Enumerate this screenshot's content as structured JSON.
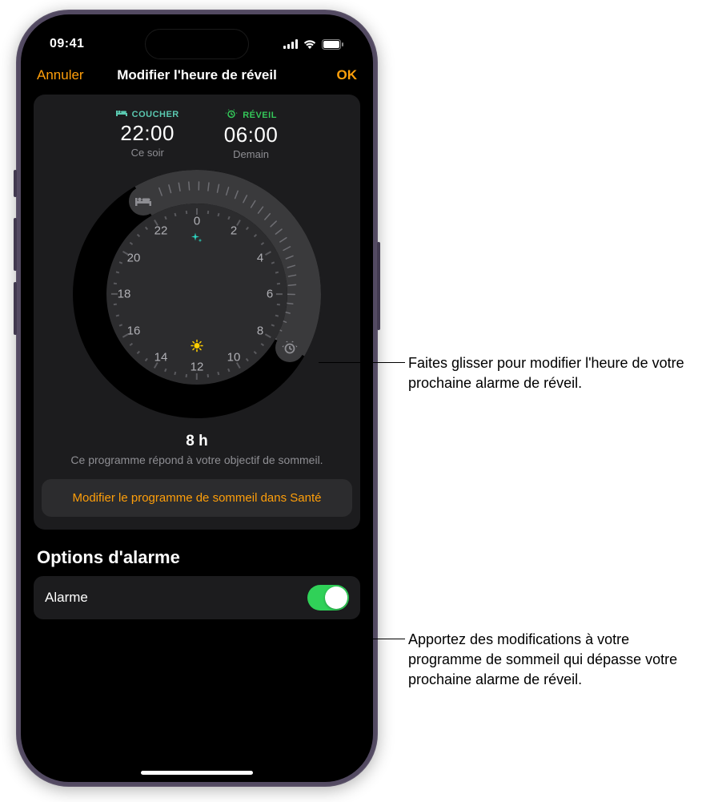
{
  "status": {
    "time": "09:41"
  },
  "nav": {
    "cancel": "Annuler",
    "title": "Modifier l'heure de réveil",
    "ok": "OK"
  },
  "schedule": {
    "bed_label": "COUCHER",
    "bed_time": "22:00",
    "bed_sub": "Ce soir",
    "wake_label": "RÉVEIL",
    "wake_time": "06:00",
    "wake_sub": "Demain"
  },
  "dial": {
    "hours": [
      "0",
      "2",
      "4",
      "6",
      "8",
      "10",
      "12",
      "14",
      "16",
      "18",
      "20",
      "22"
    ]
  },
  "duration": {
    "value": "8 h",
    "sub": "Ce programme répond à votre objectif de sommeil."
  },
  "edit_button": "Modifier le programme de sommeil dans Santé",
  "options": {
    "title": "Options d'alarme",
    "alarm_label": "Alarme",
    "alarm_on": true
  },
  "callouts": {
    "c1": "Faites glisser pour modifier l'heure de votre prochaine alarme de réveil.",
    "c2": "Apportez des modifications à votre programme de sommeil qui dépasse votre prochaine alarme de réveil."
  },
  "colors": {
    "accent": "#ff9f0a",
    "toggle_on": "#30d158"
  }
}
